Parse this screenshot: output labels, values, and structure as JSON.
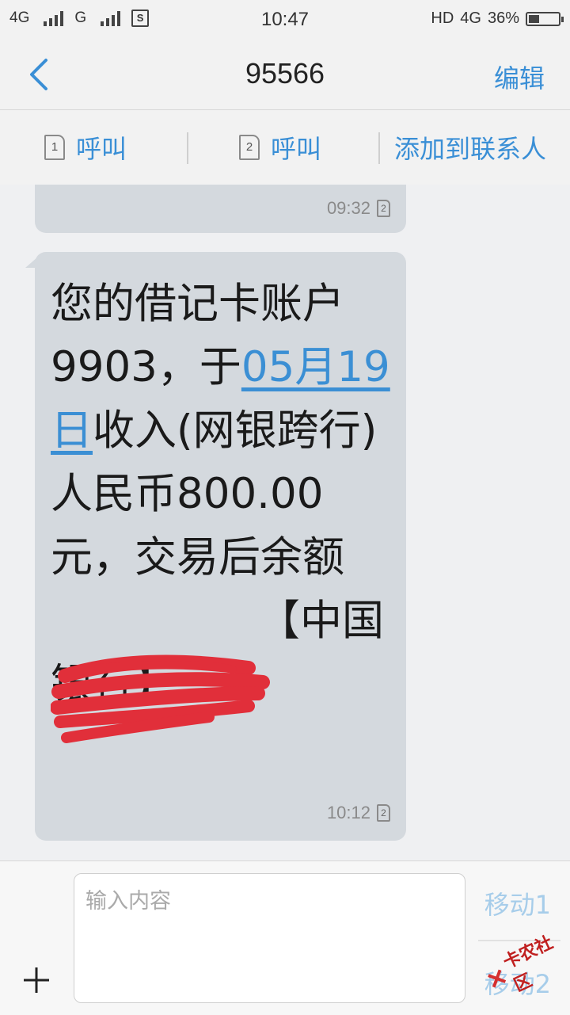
{
  "status": {
    "left_items": [
      "4G",
      "G"
    ],
    "time": "10:47",
    "right_label": "HD",
    "network": "4G",
    "battery": "36%",
    "battery_level": 0.36
  },
  "nav": {
    "title": "95566",
    "edit_label": "编辑"
  },
  "actions": {
    "sim1_num": "1",
    "call1_label": "呼叫",
    "sim2_num": "2",
    "call2_label": "呼叫",
    "add_contact_label": "添加到联系人"
  },
  "messages": [
    {
      "time": "09:32",
      "sim": "2"
    },
    {
      "text_pre": "您的借记卡账户9903，于",
      "date_link": "05月19日",
      "text_post": "收入(网银跨行)人民币800.00元，交易后余额",
      "text_tail": "【中国银行】",
      "time": "10:12",
      "sim": "2"
    }
  ],
  "composer": {
    "placeholder": "输入内容",
    "send_sim1": "移动1",
    "send_sim2": "移动2"
  },
  "watermark": {
    "text": "卡农社区"
  }
}
